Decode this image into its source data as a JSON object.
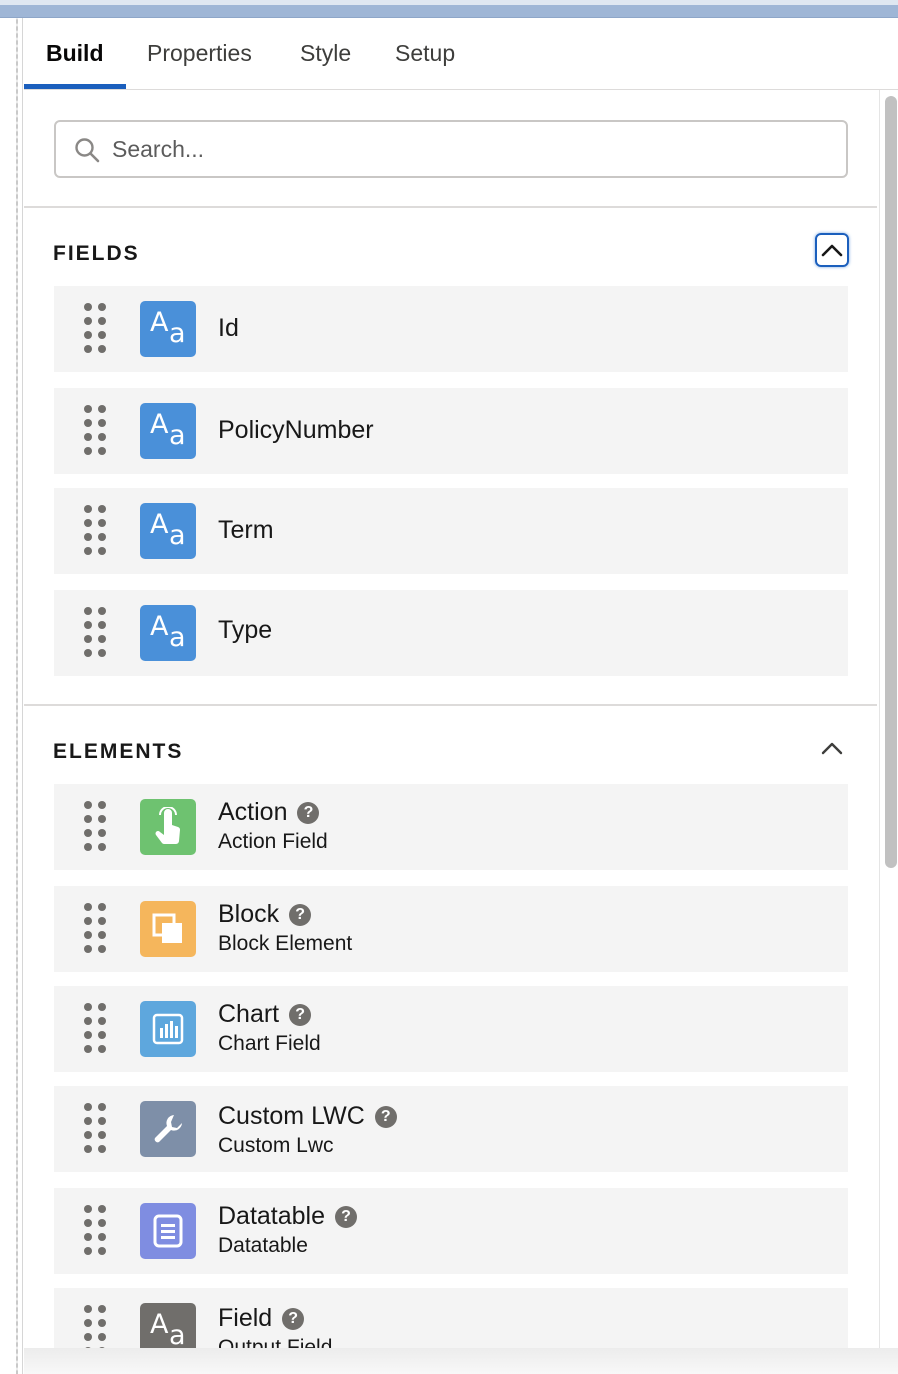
{
  "tabs": [
    {
      "label": "Build",
      "active": true
    },
    {
      "label": "Properties",
      "active": false
    },
    {
      "label": "Style",
      "active": false
    },
    {
      "label": "Setup",
      "active": false
    }
  ],
  "search": {
    "placeholder": "Search...",
    "value": ""
  },
  "fields_section": {
    "title": "FIELDS",
    "expanded": true,
    "items": [
      {
        "label": "Id",
        "icon": "text-field-icon"
      },
      {
        "label": "PolicyNumber",
        "icon": "text-field-icon"
      },
      {
        "label": "Term",
        "icon": "text-field-icon"
      },
      {
        "label": "Type",
        "icon": "text-field-icon"
      }
    ]
  },
  "elements_section": {
    "title": "ELEMENTS",
    "expanded": true,
    "items": [
      {
        "title": "Action",
        "subtitle": "Action Field",
        "icon": "touch-hand-icon",
        "color": "#6ec270"
      },
      {
        "title": "Block",
        "subtitle": "Block Element",
        "icon": "block-icon",
        "color": "#f5b65c"
      },
      {
        "title": "Chart",
        "subtitle": "Chart Field",
        "icon": "chart-icon",
        "color": "#5ea7dd"
      },
      {
        "title": "Custom LWC",
        "subtitle": "Custom Lwc",
        "icon": "wrench-icon",
        "color": "#7e8fa8"
      },
      {
        "title": "Datatable",
        "subtitle": "Datatable",
        "icon": "datatable-icon",
        "color": "#7f8de1"
      },
      {
        "title": "Field",
        "subtitle": "Output Field",
        "icon": "text-field-icon",
        "color": "#706e6b"
      }
    ]
  },
  "colors": {
    "accent": "#1b5fbd",
    "field_icon": "#4a90d9",
    "item_background": "#f4f4f4"
  }
}
